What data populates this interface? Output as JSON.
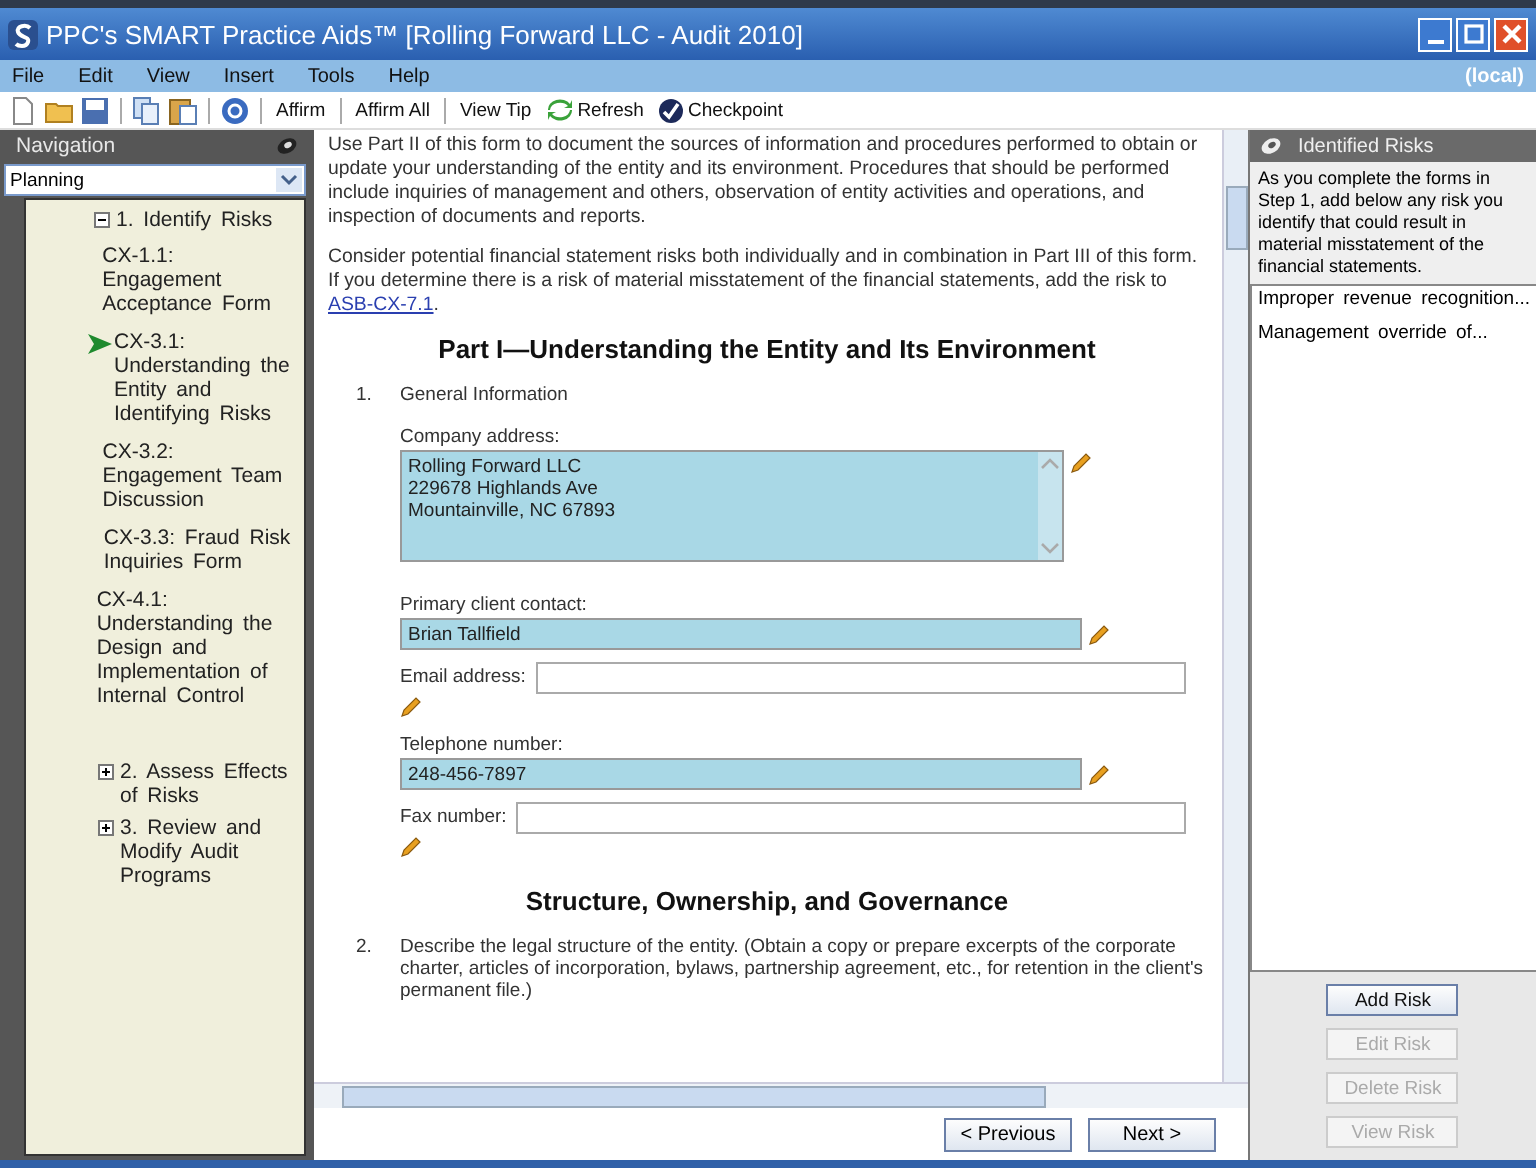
{
  "window": {
    "title": "PPC's SMART Practice Aids™ [Rolling Forward LLC - Audit 2010]",
    "buttons": [
      {
        "kind": "minimize"
      },
      {
        "kind": "maximize"
      },
      {
        "kind": "close"
      }
    ]
  },
  "menu": {
    "items": [
      "File",
      "Edit",
      "View",
      "Insert",
      "Tools",
      "Help"
    ],
    "status": "(local)"
  },
  "toolbar": [
    {
      "kind": "new"
    },
    {
      "kind": "open"
    },
    {
      "kind": "save"
    },
    {
      "kind": "sep"
    },
    {
      "kind": "copy"
    },
    {
      "kind": "paste"
    },
    {
      "kind": "sep"
    },
    {
      "kind": "help"
    },
    {
      "kind": "sep"
    },
    {
      "kind": "text",
      "label": "Affirm"
    },
    {
      "kind": "sep"
    },
    {
      "kind": "text",
      "label": "Affirm All"
    },
    {
      "kind": "sep"
    },
    {
      "kind": "text",
      "label": "View Tip"
    },
    {
      "kind": "refresh",
      "label": "Refresh"
    },
    {
      "kind": "checkpoint",
      "label": "Checkpoint"
    }
  ],
  "navigation": {
    "title": "Navigation",
    "dropdown": "Planning",
    "items": [
      {
        "label": "1. Identify Risks",
        "expanded": true,
        "children": [
          {
            "label": "CX-1.1: Engagement Acceptance Form",
            "selected": false
          },
          {
            "label": "CX-3.1: Understanding the Entity and Identifying Risks",
            "selected": true
          },
          {
            "label": "CX-3.2: Engagement Team Discussion",
            "selected": false
          },
          {
            "label": "CX-3.3: Fraud Risk Inquiries Form",
            "selected": false
          },
          {
            "label": "CX-4.1: Understanding the Design and Implementation of Internal Control",
            "selected": false
          }
        ]
      },
      {
        "label": "2. Assess Effects of Risks",
        "expanded": false
      },
      {
        "label": "3. Review and Modify Audit Programs",
        "expanded": false
      }
    ]
  },
  "document": {
    "intro": "Use Part II of this form to document the sources of information and procedures performed to obtain or update your understanding of the entity and its environment. Procedures that should be performed include inquiries of management and others, observation of entity activities and operations, and inspection of documents and reports.",
    "consider": "Consider potential financial statement risks both individually and in combination in Part III of this form. If you determine there is a risk of material misstatement of the financial statements, add the risk to",
    "link": "ASB-CX-7.1",
    "link_suffix": ".",
    "heading": "Part I—Understanding the Entity and Its Environment",
    "q1": {
      "number": "1.",
      "label": "General Information",
      "address_label": "Company address:",
      "address": [
        "Rolling Forward LLC",
        "229678 Highlands Ave",
        "Mountainville, NC 67893"
      ],
      "fields": [
        {
          "label": "Primary client contact:",
          "value": "Brian Tallfield",
          "filled": true
        },
        {
          "label": "Email address:",
          "filled": false
        },
        {
          "label": "Telephone number:",
          "value": "248-456-7897",
          "filled": true
        },
        {
          "label": "Fax number:",
          "filled": false
        }
      ]
    },
    "heading2": "Structure, Ownership, and Governance",
    "q2": {
      "number": "2.",
      "text": "Describe the legal structure of the entity. (Obtain a copy or prepare excerpts of the corporate charter, articles of incorporation, bylaws, partnership agreement, etc., for retention in the client's permanent file.)"
    },
    "buttons": [
      "< Previous",
      "Next >"
    ]
  },
  "risks": {
    "title": "Identified Risks",
    "hint": "As you complete the forms in Step 1, add below any risk you identify that could result in material misstatement of the financial statements.",
    "items": [
      "Improper revenue recognition...",
      "Management override of..."
    ],
    "buttons": [
      {
        "label": "Add Risk",
        "disabled": false
      },
      {
        "label": "Edit Risk",
        "disabled": true
      },
      {
        "label": "Delete Risk",
        "disabled": true
      },
      {
        "label": "View Risk",
        "disabled": true
      }
    ]
  }
}
